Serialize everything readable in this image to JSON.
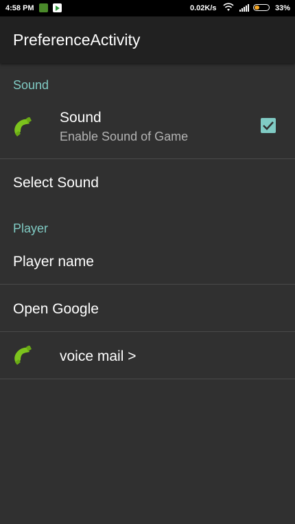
{
  "status_bar": {
    "time": "4:58 PM",
    "speed": "0.02K/s",
    "battery": "33%",
    "battery_level": 0.33
  },
  "app_bar": {
    "title": "PreferenceActivity"
  },
  "sections": {
    "sound": {
      "header": "Sound",
      "sound_pref": {
        "title": "Sound",
        "summary": "Enable Sound of Game",
        "icon": "phone-icon",
        "checked": true
      },
      "select_sound": "Select Sound"
    },
    "player": {
      "header": "Player",
      "player_name": "Player name",
      "open_google": "Open Google",
      "voice_mail": {
        "title": "voice mail >",
        "icon": "phone-icon"
      }
    }
  },
  "colors": {
    "accent": "#80cbc4",
    "background": "#303030",
    "app_bar": "#212121",
    "icon_green": "#7cc31d"
  }
}
